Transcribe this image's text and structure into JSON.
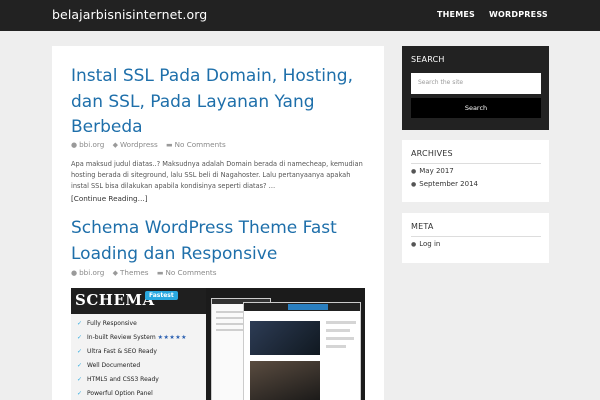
{
  "site": {
    "title": "belajarbisnisinternet.org"
  },
  "nav": {
    "items": [
      {
        "label": "THEMES"
      },
      {
        "label": "WORDPRESS"
      }
    ]
  },
  "posts": [
    {
      "title_lines": [
        "Instal SSL Pada Domain, Hosting,",
        "dan SSL, Pada Layanan Yang",
        "Berbeda"
      ],
      "author": "bbi.org",
      "category": "Wordpress",
      "comments": "No Comments",
      "excerpt": "Apa maksud judul diatas..? Maksudnya adalah Domain berada di namecheap, kemudian hosting berada di siteground, lalu SSL beli di Nagahoster. Lalu pertanyaanya apakah instal SSL bisa dilakukan apabila kondisinya seperti diatas? …",
      "read_more": "[Continue Reading…]"
    },
    {
      "title_lines": [
        "Schema WordPress Theme Fast",
        "Loading dan Responsive"
      ],
      "author": "bbi.org",
      "category": "Themes",
      "comments": "No Comments"
    }
  ],
  "promo": {
    "logo": "SCHEMA",
    "badge": "Fastest",
    "features": [
      "Fully Responsive",
      "In-built Review System",
      "Ultra Fast & SEO Ready",
      "Well Documented",
      "HTML5 and CSS3 Ready",
      "Powerful Option Panel"
    ],
    "stars": "★★★★★"
  },
  "sidebar": {
    "search": {
      "title": "SEARCH",
      "placeholder": "Search the site",
      "button": "Search"
    },
    "archives": {
      "title": "ARCHIVES",
      "items": [
        "May 2017",
        "September 2014"
      ]
    },
    "meta": {
      "title": "META",
      "items": [
        "Log in"
      ]
    }
  },
  "icons": {
    "author": "user-icon",
    "category": "tag-icon",
    "comments": "comment-icon"
  },
  "colors": {
    "link": "#1e6faa",
    "topbar": "#222222",
    "background": "#eeeeee"
  }
}
